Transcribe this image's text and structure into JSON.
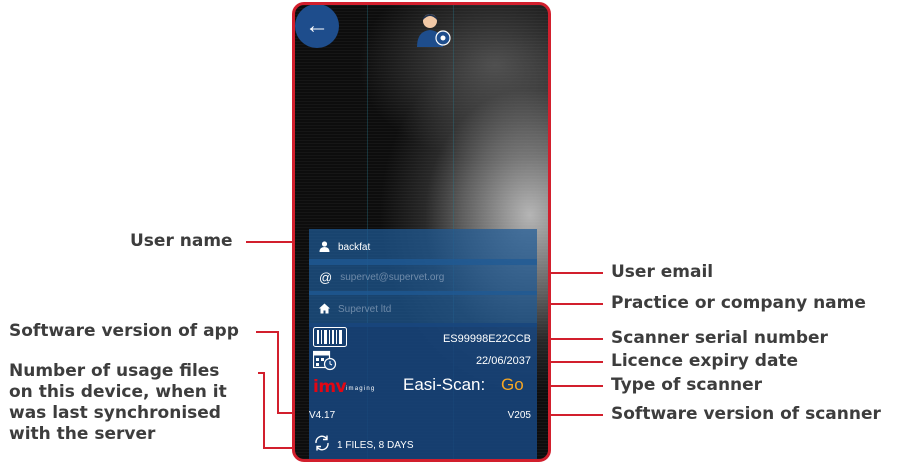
{
  "labels": {
    "user_name": "User name",
    "user_email": "User email",
    "practice": "Practice or company name",
    "software_app": "Software version of app",
    "serial": "Scanner serial number",
    "licence": "Licence expiry date",
    "usage": "Number of usage files on this device, when it was last synchronised with the server",
    "scanner_type": "Type of scanner",
    "software_scanner": "Software version of scanner"
  },
  "screen": {
    "user_name": "backfat",
    "email_placeholder": "supervet@supervet.org",
    "practice_placeholder": "Supervet ltd",
    "serial": "ES99998E22CCB",
    "expiry": "22/06/2037",
    "brand_imv": "imv",
    "brand_imaging": "imaging",
    "brand_easi": "Easi-Scan:",
    "brand_go": "Go",
    "app_version": "V4.17",
    "scanner_version": "V205",
    "sync_status": "1 FILES, 8 DAYS"
  },
  "icons": {
    "back": "arrow-left-icon",
    "user_settings": "user-gear-icon",
    "user": "person-icon",
    "email": "at-icon",
    "home": "home-icon",
    "barcode": "barcode-icon",
    "calendar": "calendar-clock-icon",
    "sync": "sync-icon"
  },
  "colors": {
    "accent_red": "#d21f2d",
    "header_blue": "#1e4d8c",
    "panel_blue": "#18467d",
    "go_orange": "#f6a623"
  }
}
